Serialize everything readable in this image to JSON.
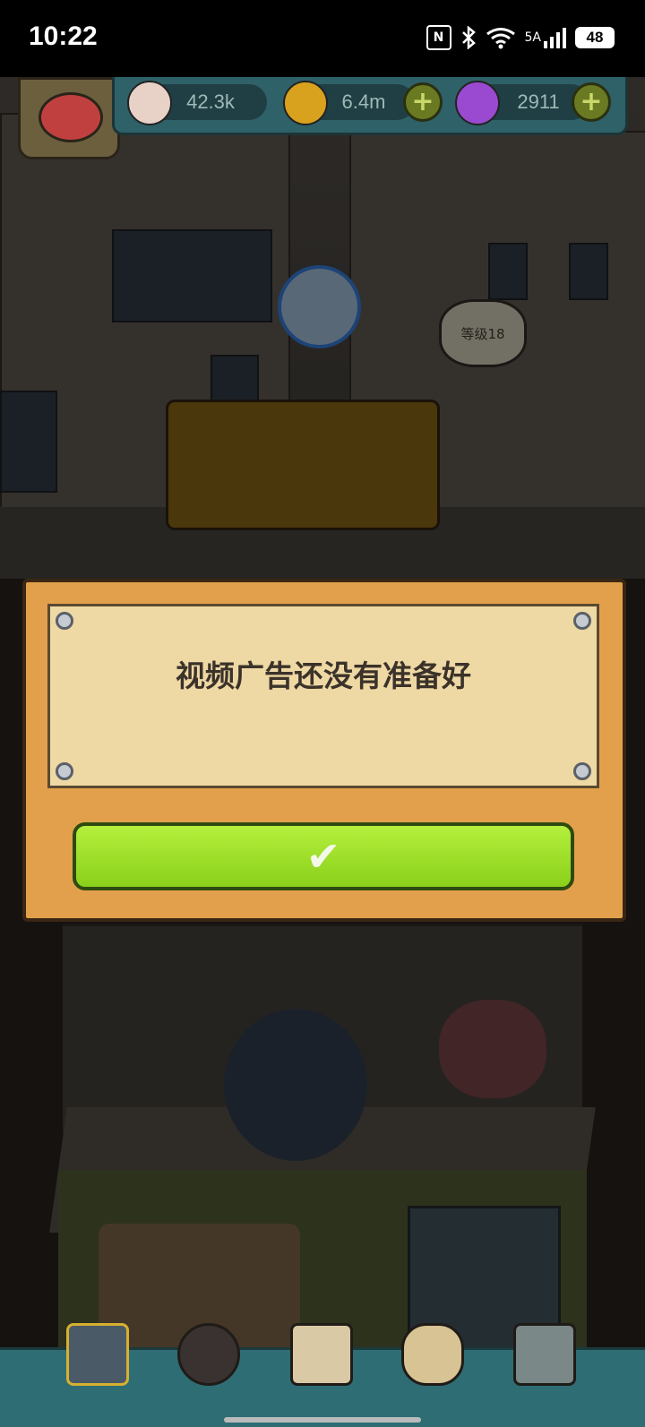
{
  "status_bar": {
    "time": "10:22",
    "nfc_label": "N",
    "bluetooth_icon": "bluetooth-icon",
    "wifi_icon": "wifi-6-icon",
    "signal_label": "5A",
    "battery_label": "48"
  },
  "hud": {
    "eyeballs": "42.3k",
    "coins": "6.4m",
    "potions": "2911"
  },
  "scene": {
    "level_bubble": "等级18"
  },
  "dialog": {
    "message": "视频广告还没有准备好",
    "confirm_icon": "checkmark-icon"
  },
  "bottom_nav": {
    "items": [
      "building-icon",
      "monster-icon",
      "recipe-book-icon",
      "money-bag-icon",
      "monster-grid-icon"
    ]
  },
  "colors": {
    "hud_bg": "#2f6168",
    "dialog_frame": "#e3a04c",
    "paper": "#eed8a4",
    "confirm_green": "#8ad01a"
  }
}
